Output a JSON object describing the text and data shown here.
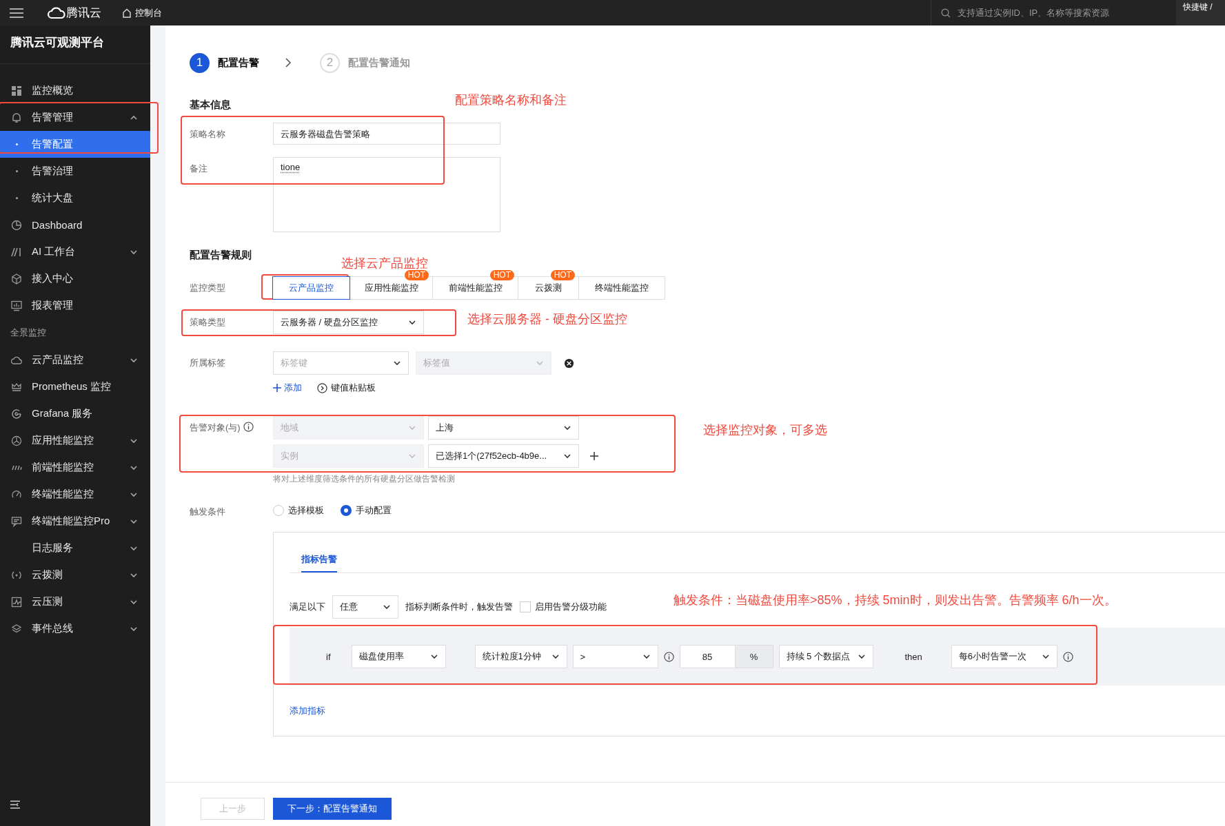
{
  "topbar": {
    "brand": "腾讯云",
    "console": "控制台",
    "search": {
      "placeholder": "支持通过实例ID、IP、名称等搜索资源"
    },
    "shortcut": "快捷键 /"
  },
  "sidebar": {
    "title": "腾讯云可观测平台",
    "items": [
      {
        "label": "监控概览",
        "kind": "link",
        "selected": false
      },
      {
        "label": "告警管理",
        "kind": "group",
        "expanded": true,
        "selected": false
      },
      {
        "label": "告警配置",
        "kind": "child",
        "selected": true
      },
      {
        "label": "告警治理",
        "kind": "child",
        "selected": false
      },
      {
        "label": "统计大盘",
        "kind": "child",
        "selected": false
      },
      {
        "label": "Dashboard",
        "kind": "link",
        "selected": false
      },
      {
        "label": "AI 工作台",
        "kind": "group",
        "expanded": false,
        "selected": false
      },
      {
        "label": "接入中心",
        "kind": "link",
        "selected": false
      },
      {
        "label": "报表管理",
        "kind": "link",
        "selected": false
      },
      {
        "label": "全景监控",
        "kind": "section"
      },
      {
        "label": "云产品监控",
        "kind": "group",
        "expanded": false,
        "selected": false
      },
      {
        "label": "Prometheus 监控",
        "kind": "link",
        "selected": false
      },
      {
        "label": "Grafana 服务",
        "kind": "link",
        "selected": false
      },
      {
        "label": "应用性能监控",
        "kind": "group",
        "expanded": false,
        "selected": false
      },
      {
        "label": "前端性能监控",
        "kind": "group",
        "expanded": false,
        "selected": false
      },
      {
        "label": "终端性能监控",
        "kind": "group",
        "expanded": false,
        "selected": false
      },
      {
        "label": "终端性能监控Pro",
        "kind": "group",
        "expanded": false,
        "selected": false
      },
      {
        "label": "日志服务",
        "kind": "group",
        "expanded": false,
        "selected": false
      },
      {
        "label": "云拨测",
        "kind": "group",
        "expanded": false,
        "selected": false
      },
      {
        "label": "云压测",
        "kind": "group",
        "expanded": false,
        "selected": false
      },
      {
        "label": "事件总线",
        "kind": "group",
        "expanded": false,
        "selected": false
      }
    ]
  },
  "steps": [
    {
      "number": "1",
      "label": "配置告警",
      "selected": true
    },
    {
      "number": "2",
      "label": "配置告警通知",
      "selected": false
    }
  ],
  "basic_info": {
    "title": "基本信息",
    "fields": [
      {
        "label": "策略名称",
        "value": "云服务器磁盘告警策略",
        "kind": "input"
      },
      {
        "label": "备注",
        "value": "tione",
        "kind": "textarea"
      }
    ]
  },
  "rules": {
    "title": "配置告警规则",
    "monitor_type": {
      "label": "监控类型",
      "options": [
        {
          "label": "云产品监控",
          "selected": true
        },
        {
          "label": "应用性能监控",
          "badge": "HOT",
          "selected": false
        },
        {
          "label": "前端性能监控",
          "badge": "HOT",
          "selected": false
        },
        {
          "label": "云拨测",
          "badge": "HOT",
          "selected": false
        },
        {
          "label": "终端性能监控",
          "selected": false
        }
      ]
    },
    "policy_type": {
      "label": "策略类型",
      "value": "云服务器 / 硬盘分区监控"
    },
    "tags": {
      "label": "所属标签",
      "key": {
        "placeholder": "标签键",
        "disabled": false
      },
      "value": {
        "placeholder": "标签值",
        "disabled": true
      },
      "add": "添加",
      "paste": "键值粘贴板"
    },
    "targets": {
      "label": "告警对象(与)",
      "rows": [
        {
          "dimension": {
            "value": "地域",
            "disabled": true
          },
          "value": "上海"
        },
        {
          "dimension": {
            "value": "实例",
            "disabled": true
          },
          "value": "已选择1个(27f52ecb-4b9e..."
        }
      ],
      "hint": "将对上述维度筛选条件的所有硬盘分区做告警检测"
    },
    "trigger": {
      "label": "触发条件",
      "modes": [
        {
          "label": "选择模板",
          "selected": false
        },
        {
          "label": "手动配置",
          "selected": true
        }
      ],
      "tabs": [
        {
          "label": "指标告警",
          "selected": true
        }
      ],
      "match": {
        "prefix": "满足以下",
        "value": "任意",
        "suffix": "指标判断条件时，触发告警",
        "grading": {
          "label": "启用告警分级功能",
          "checked": false
        }
      },
      "condition": {
        "if": "if",
        "metric": "磁盘使用率",
        "period": "统计粒度1分钟",
        "operator": ">",
        "threshold": "85",
        "unit": "%",
        "duration": "持续 5 个数据点",
        "then": "then",
        "frequency": "每6小时告警一次"
      },
      "add_metric": "添加指标"
    }
  },
  "footer": {
    "buttons": [
      {
        "label": "上一步",
        "disabled": true
      },
      {
        "label": "下一步：配置告警通知",
        "disabled": false
      }
    ]
  },
  "notes": [
    "配置策略名称和备注",
    "选择云产品监控",
    "选择云服务器 - 硬盘分区监控",
    "选择监控对象，可多选",
    "触发条件：当磁盘使用率>85%，持续 5min时，则发出告警。告警频率 6/h一次。"
  ]
}
